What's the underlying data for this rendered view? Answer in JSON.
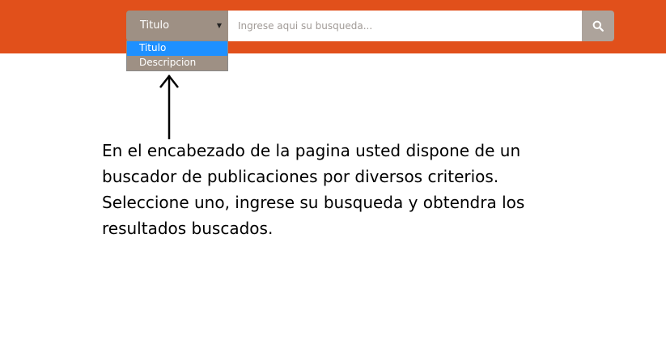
{
  "header": {
    "color": "#e1501b",
    "search": {
      "criteria_selected": "Titulo",
      "criteria_options": [
        "Titulo",
        "Descripcion"
      ],
      "highlighted_option": "Titulo",
      "placeholder": "Ingrese aqui su busqueda...",
      "button_icon": "search-icon"
    }
  },
  "annotation": {
    "arrow_icon": "arrow-up-icon",
    "lines": [
      "En el encabezado de la pagina usted dispone de un",
      "buscador de publicaciones por diversos criterios.",
      "Seleccione uno, ingrese su busqueda y obtendra los",
      "resultados buscados."
    ]
  }
}
